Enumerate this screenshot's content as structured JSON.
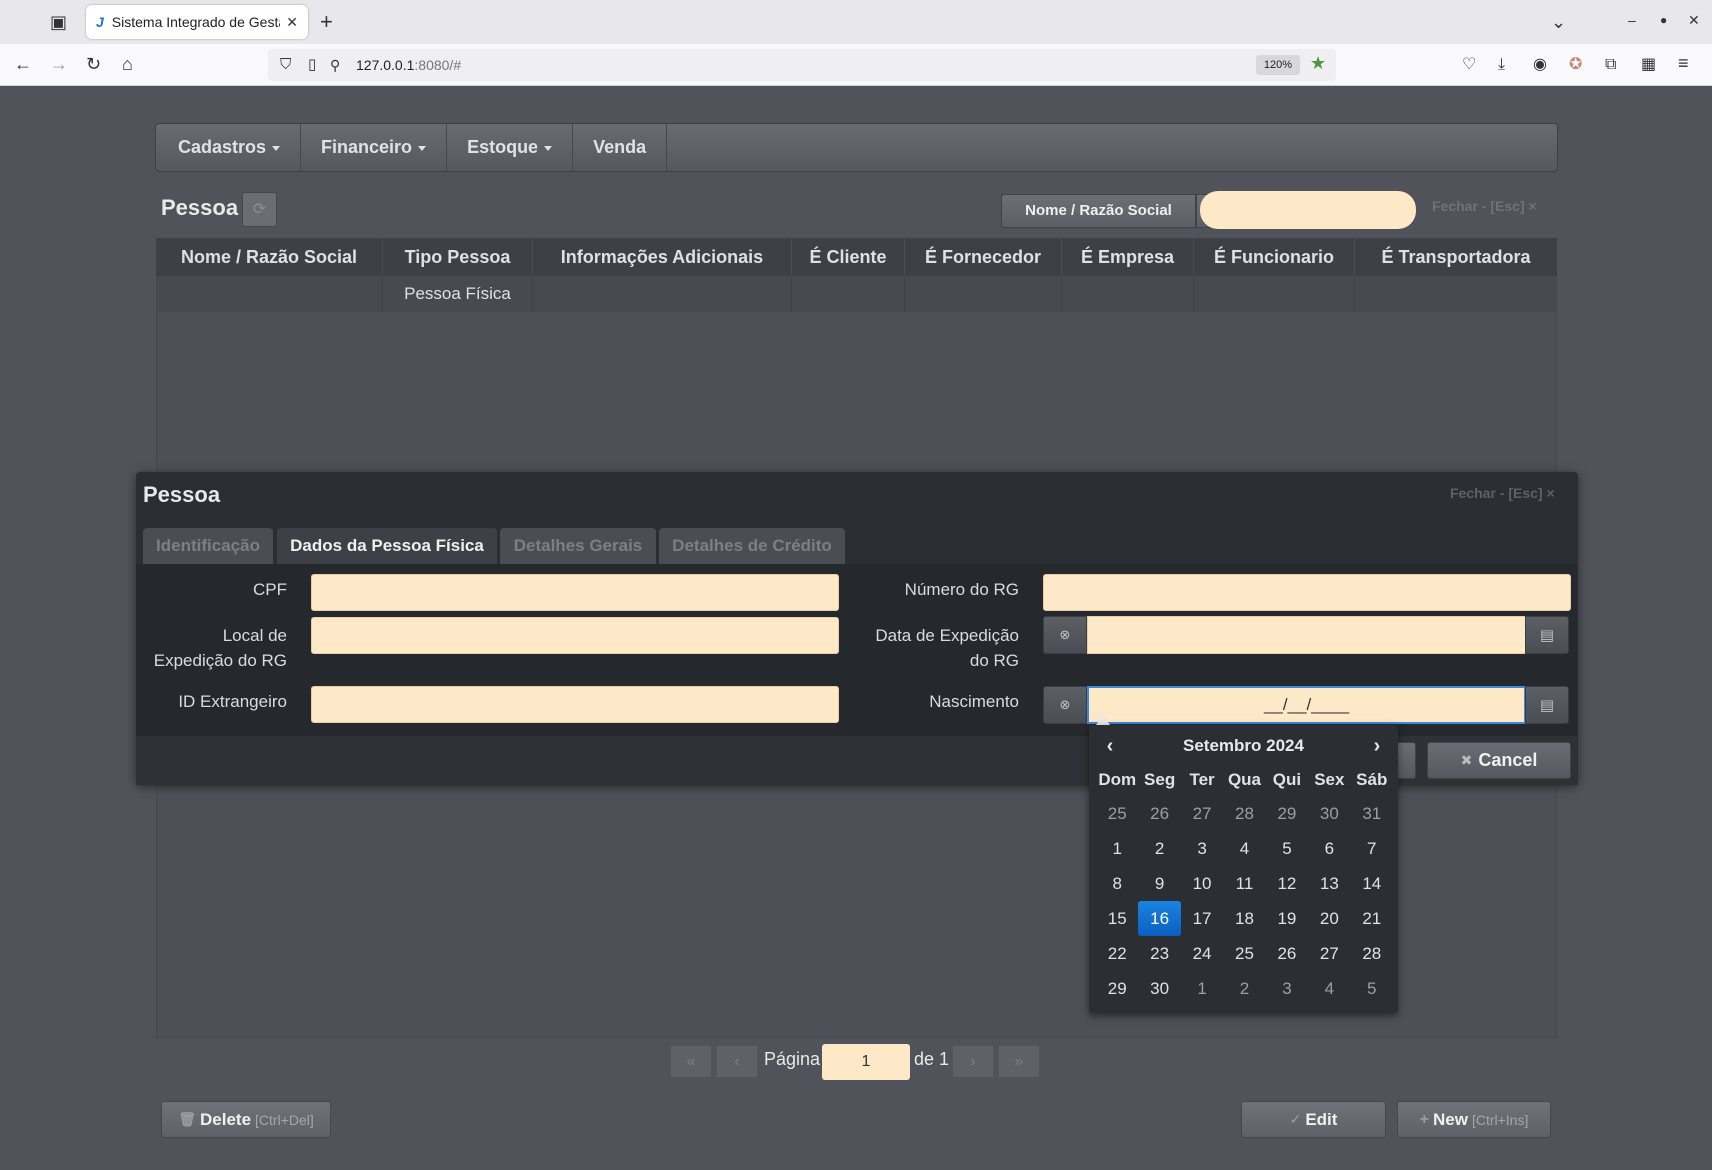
{
  "browser": {
    "tab_title": "Sistema Integrado de Gestã",
    "tab_favicon": "J",
    "url_host": "127.0.0.1",
    "url_rest": ":8080/#",
    "zoom": "120%"
  },
  "menu": {
    "items": [
      {
        "label": "Cadastros",
        "dropdown": true
      },
      {
        "label": "Financeiro",
        "dropdown": true
      },
      {
        "label": "Estoque",
        "dropdown": true
      },
      {
        "label": "Venda",
        "dropdown": false
      }
    ]
  },
  "page": {
    "title": "Pessoa",
    "search_field_select": "Nome / Razão Social",
    "search_value": "",
    "close_label": "Fechar - [Esc]"
  },
  "grid": {
    "columns": [
      "Nome / Razão Social",
      "Tipo Pessoa",
      "Informações Adicionais",
      "É Cliente",
      "É Fornecedor",
      "É Empresa",
      "É Funcionario",
      "É Transportadora"
    ],
    "rows": [
      [
        "",
        "Pessoa Física",
        "",
        "",
        "",
        "",
        "",
        ""
      ]
    ]
  },
  "pager": {
    "page_label": "Página",
    "page_value": "1",
    "of_label": "de 1"
  },
  "actions": {
    "delete_label": "Delete",
    "delete_key": "[Ctrl+Del]",
    "edit_label": "Edit",
    "new_label": "New",
    "new_key": "[Ctrl+Ins]"
  },
  "dialog": {
    "title": "Pessoa",
    "close_label": "Fechar - [Esc]",
    "tabs": [
      "Identificação",
      "Dados da Pessoa Física",
      "Detalhes Gerais",
      "Detalhes de Crédito"
    ],
    "active_tab": 1,
    "fields": {
      "cpf_label": "CPF",
      "cpf_value": "",
      "rg_number_label": "Número do RG",
      "rg_number_value": "",
      "rg_place_label_1": "Local de",
      "rg_place_label_2": "Expedição do RG",
      "rg_place_value": "",
      "rg_date_label_1": "Data de Expedição",
      "rg_date_label_2": "do RG",
      "rg_date_value": "",
      "foreign_id_label": "ID Extrangeiro",
      "foreign_id_value": "",
      "birth_label": "Nascimento",
      "birth_value": "__/__/____"
    },
    "cancel_label": "Cancel"
  },
  "calendar": {
    "month_label": "Setembro 2024",
    "prev": "‹",
    "next": "›",
    "weekdays": [
      "Dom",
      "Seg",
      "Ter",
      "Qua",
      "Qui",
      "Sex",
      "Sáb"
    ],
    "weeks": [
      [
        {
          "d": "25",
          "o": true
        },
        {
          "d": "26",
          "o": true
        },
        {
          "d": "27",
          "o": true
        },
        {
          "d": "28",
          "o": true
        },
        {
          "d": "29",
          "o": true
        },
        {
          "d": "30",
          "o": true
        },
        {
          "d": "31",
          "o": true
        }
      ],
      [
        {
          "d": "1"
        },
        {
          "d": "2"
        },
        {
          "d": "3"
        },
        {
          "d": "4"
        },
        {
          "d": "5"
        },
        {
          "d": "6"
        },
        {
          "d": "7"
        }
      ],
      [
        {
          "d": "8"
        },
        {
          "d": "9"
        },
        {
          "d": "10"
        },
        {
          "d": "11"
        },
        {
          "d": "12"
        },
        {
          "d": "13"
        },
        {
          "d": "14"
        }
      ],
      [
        {
          "d": "15"
        },
        {
          "d": "16",
          "sel": true
        },
        {
          "d": "17"
        },
        {
          "d": "18"
        },
        {
          "d": "19"
        },
        {
          "d": "20"
        },
        {
          "d": "21"
        }
      ],
      [
        {
          "d": "22"
        },
        {
          "d": "23"
        },
        {
          "d": "24"
        },
        {
          "d": "25"
        },
        {
          "d": "26"
        },
        {
          "d": "27"
        },
        {
          "d": "28"
        }
      ],
      [
        {
          "d": "29"
        },
        {
          "d": "30"
        },
        {
          "d": "1",
          "o": true
        },
        {
          "d": "2",
          "o": true
        },
        {
          "d": "3",
          "o": true
        },
        {
          "d": "4",
          "o": true
        },
        {
          "d": "5",
          "o": true
        }
      ]
    ]
  },
  "colors": {
    "background": "#50545a",
    "input_bg": "#fde8c7",
    "selected_day": "#0a60c0",
    "dialog_bg": "#2b2e32"
  }
}
